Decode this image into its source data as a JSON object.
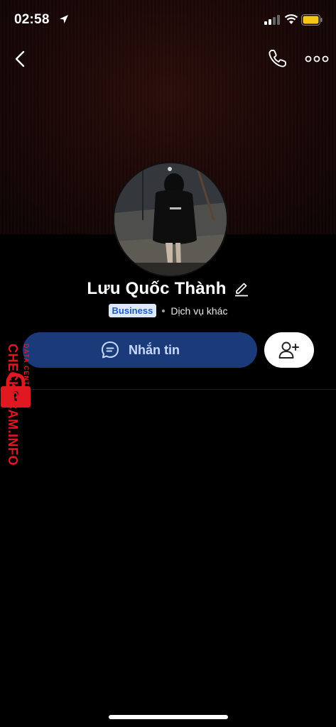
{
  "status_bar": {
    "time": "02:58"
  },
  "profile": {
    "name": "Lưu Quốc Thành",
    "badge": "Business",
    "category": "Dịch vụ khác"
  },
  "actions": {
    "message_label": "Nhắn tin"
  },
  "watermark": {
    "main": "CHECKSCAM.INFO",
    "sub": "DATA CENTER"
  },
  "colors": {
    "message_button_bg": "#1a3a7a",
    "message_button_text": "#c8dafb",
    "badge_bg": "#dce8fb",
    "badge_text": "#1f58c8",
    "watermark": "#e01822"
  },
  "icons": {
    "back": "chevron-left-icon",
    "call": "phone-icon",
    "more": "more-dots-icon",
    "edit": "pencil-icon",
    "message": "chat-bubble-icon",
    "add_friend": "add-user-icon"
  }
}
